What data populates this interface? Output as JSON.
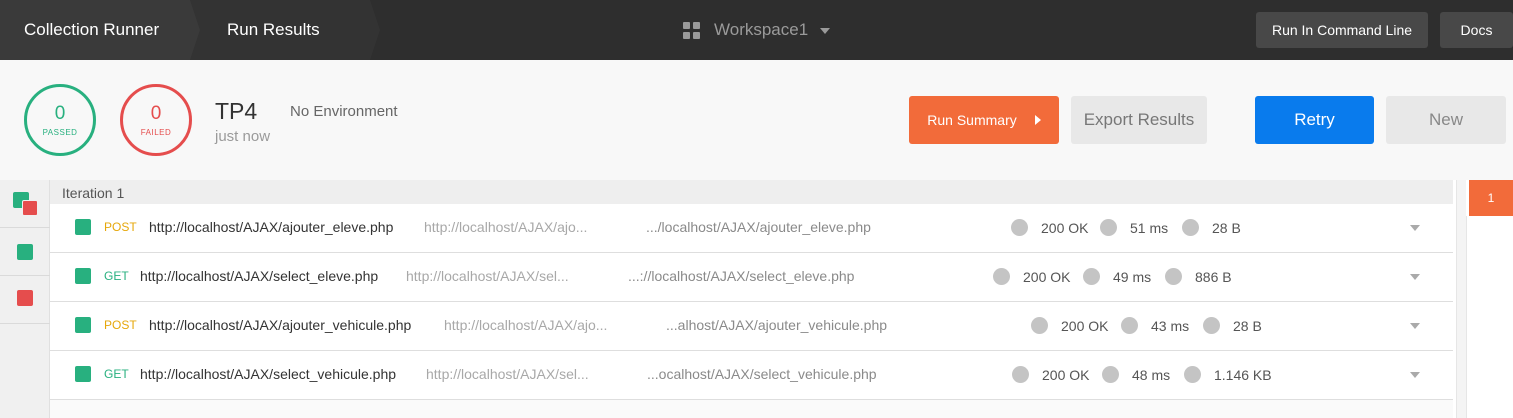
{
  "breadcrumb": {
    "collection_runner": "Collection Runner",
    "run_results": "Run Results"
  },
  "workspace": {
    "name": "Workspace1",
    "icon": "grid-icon"
  },
  "top_actions": {
    "run_cmd": "Run In Command Line",
    "docs": "Docs"
  },
  "summary": {
    "passed": {
      "count": "0",
      "label": "PASSED"
    },
    "failed": {
      "count": "0",
      "label": "FAILED"
    },
    "collection_name": "TP4",
    "time": "just now",
    "environment": "No Environment",
    "run_summary": "Run Summary",
    "export": "Export Results",
    "retry": "Retry",
    "new": "New"
  },
  "iteration": {
    "label": "Iteration 1",
    "badge": "1"
  },
  "requests": [
    {
      "method": "POST",
      "url": "http://localhost/AJAX/ajouter_eleve.php",
      "short_url": "http://localhost/AJAX/ajo...",
      "resolved": ".../localhost/AJAX/ajouter_eleve.php",
      "status": "200 OK",
      "time": "51 ms",
      "size": "28 B"
    },
    {
      "method": "GET",
      "url": "http://localhost/AJAX/select_eleve.php",
      "short_url": "http://localhost/AJAX/sel...",
      "resolved": "...://localhost/AJAX/select_eleve.php",
      "status": "200 OK",
      "time": "49 ms",
      "size": "886 B"
    },
    {
      "method": "POST",
      "url": "http://localhost/AJAX/ajouter_vehicule.php",
      "short_url": "http://localhost/AJAX/ajo...",
      "resolved": "...alhost/AJAX/ajouter_vehicule.php",
      "status": "200 OK",
      "time": "43 ms",
      "size": "28 B"
    },
    {
      "method": "GET",
      "url": "http://localhost/AJAX/select_vehicule.php",
      "short_url": "http://localhost/AJAX/sel...",
      "resolved": "...ocalhost/AJAX/select_vehicule.php",
      "status": "200 OK",
      "time": "48 ms",
      "size": "1.146 KB"
    }
  ],
  "colors": {
    "pass": "#28b07f",
    "fail": "#e54d4d",
    "accent": "#f26b3a",
    "primary": "#097bed",
    "post": "#e6a70a"
  }
}
